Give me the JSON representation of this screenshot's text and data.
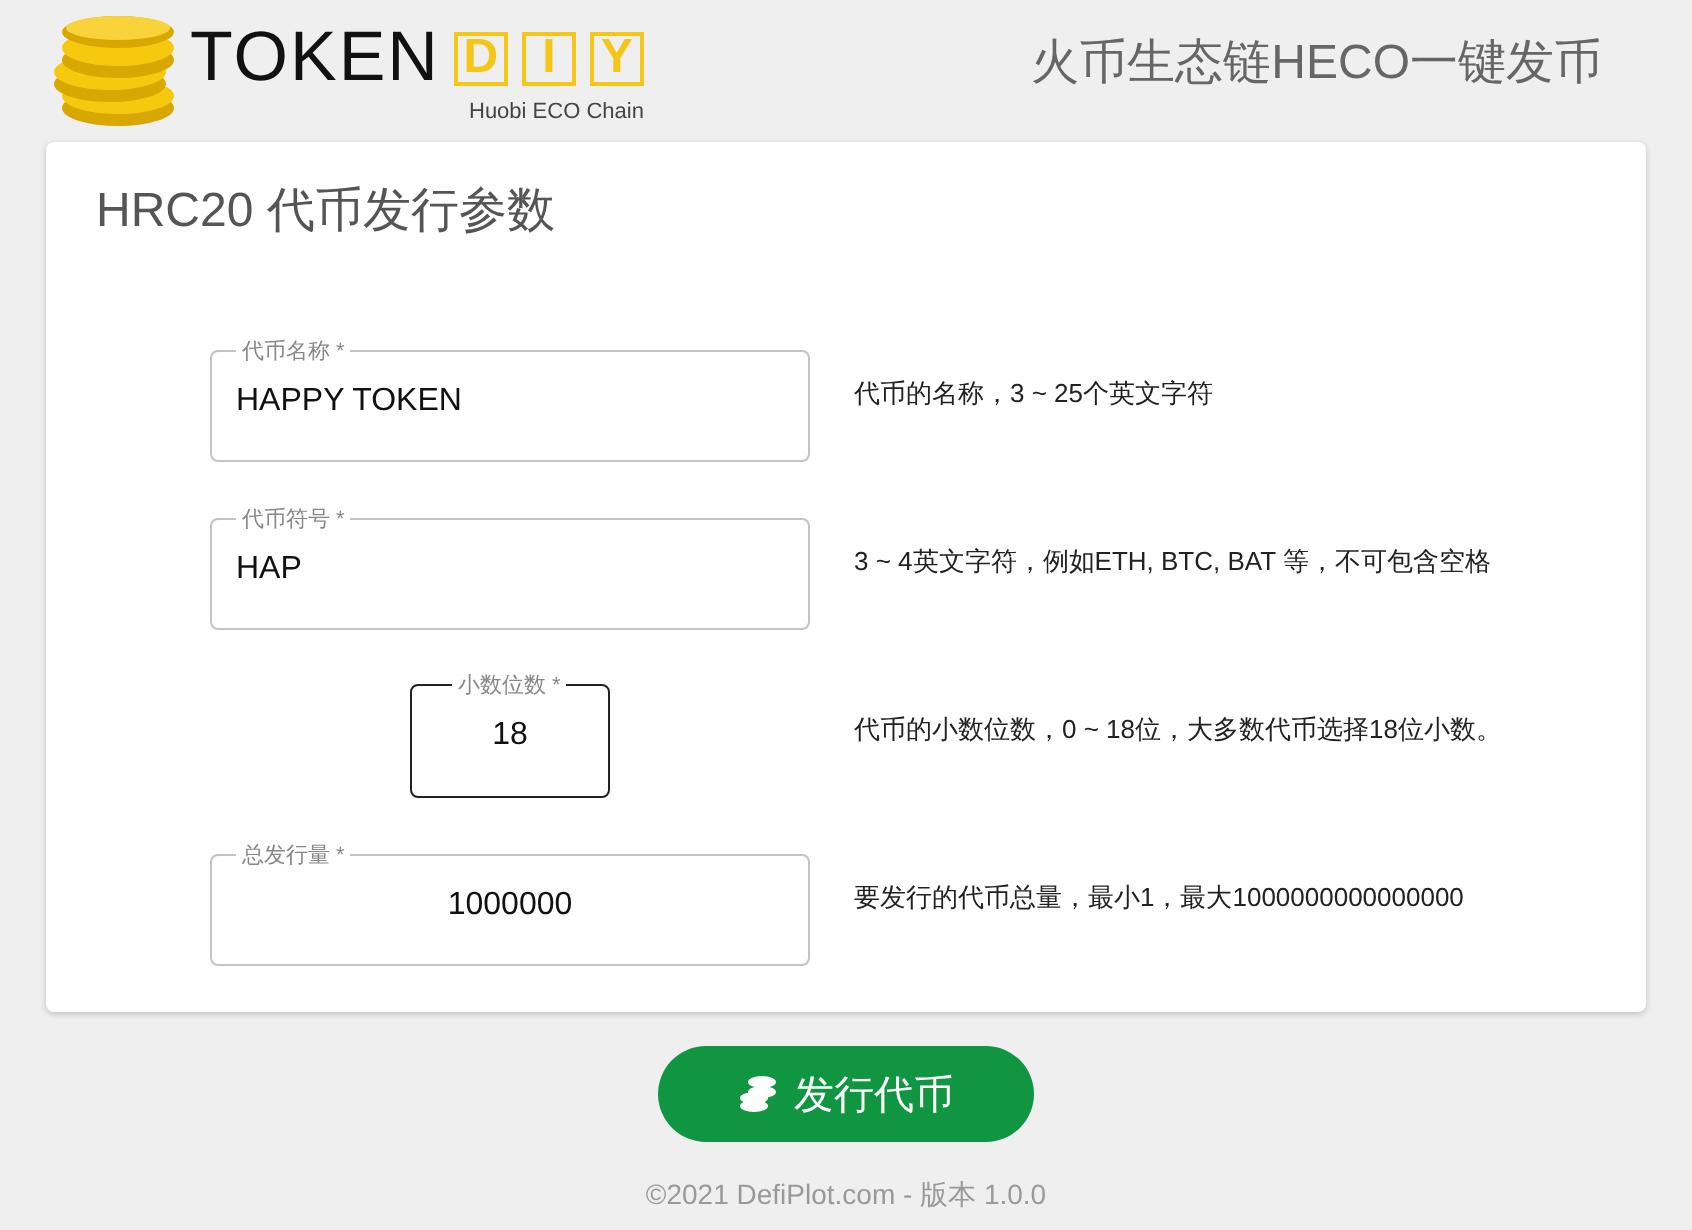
{
  "header": {
    "logo": {
      "word": "TOKEN",
      "boxed_letters": [
        "D",
        "I",
        "Y"
      ],
      "subtitle": "Huobi ECO Chain"
    },
    "tagline": "火币生态链HECO一键发币"
  },
  "form": {
    "title": "HRC20 代币发行参数",
    "fields": [
      {
        "label": "代币名称 *",
        "value": "HAPPY TOKEN",
        "kind": "text",
        "focused": false,
        "hint": "代币的名称，3 ~ 25个英文字符"
      },
      {
        "label": "代币符号 *",
        "value": "HAP",
        "kind": "text",
        "focused": false,
        "hint": "3 ~ 4英文字符，例如ETH, BTC, BAT 等，不可包含空格"
      },
      {
        "label": "小数位数 *",
        "value": "18",
        "kind": "digits",
        "focused": true,
        "hint": "代币的小数位数，0 ~ 18位，大多数代币选择18位小数。"
      },
      {
        "label": "总发行量 *",
        "value": "1000000",
        "kind": "amount",
        "focused": false,
        "hint": "要发行的代币总量，最小1，最大1000000000000000"
      }
    ]
  },
  "submit_button": "发行代币",
  "footer": "©2021 DefiPlot.com - 版本 1.0.0"
}
